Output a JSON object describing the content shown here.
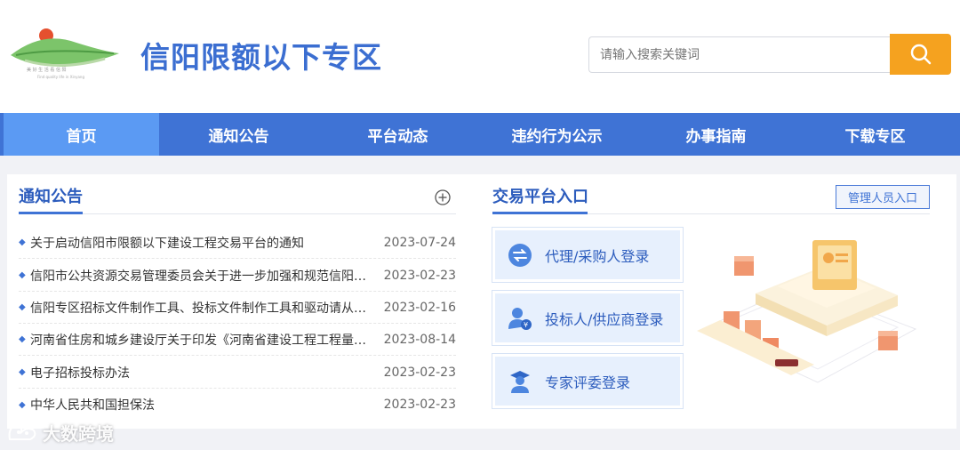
{
  "header": {
    "site_title": "信阳限额以下专区",
    "logo_name": "logo-icon",
    "search_placeholder": "请输入搜索关键词"
  },
  "nav": {
    "items": [
      {
        "label": "首页",
        "active": true
      },
      {
        "label": "通知公告"
      },
      {
        "label": "平台动态"
      },
      {
        "label": "违约行为公示"
      },
      {
        "label": "办事指南"
      },
      {
        "label": "下载专区"
      }
    ]
  },
  "notices": {
    "title": "通知公告",
    "items": [
      {
        "text": "关于启动信阳市限额以下建设工程交易平台的通知",
        "date": "2023-07-24"
      },
      {
        "text": "信阳市公共资源交易管理委员会关于进一步加强和规范信阳市限额以下建设工程交易活动的通知",
        "date": "2023-02-23"
      },
      {
        "text": "信阳专区招标文件制作工具、投标文件制作工具和驱动请从下载专区下载",
        "date": "2023-02-16"
      },
      {
        "text": "河南省住房和城乡建设厅关于印发《河南省建设工程工程量清单招标评标办法》的通知",
        "date": "2023-08-14"
      },
      {
        "text": "电子招标投标办法",
        "date": "2023-02-23"
      },
      {
        "text": "中华人民共和国担保法",
        "date": "2023-02-23"
      }
    ]
  },
  "platform": {
    "title": "交易平台入口",
    "admin_label": "管理人员入口",
    "logins": [
      {
        "label": "代理/采购人登录",
        "icon": "exchange-icon"
      },
      {
        "label": "投标人/供应商登录",
        "icon": "bidder-icon"
      },
      {
        "label": "专家评委登录",
        "icon": "expert-icon"
      }
    ]
  },
  "watermark": "大数跨境",
  "colors": {
    "primary": "#3f73d5",
    "accent": "#f5a21f",
    "nav_active": "#5b9af3"
  }
}
